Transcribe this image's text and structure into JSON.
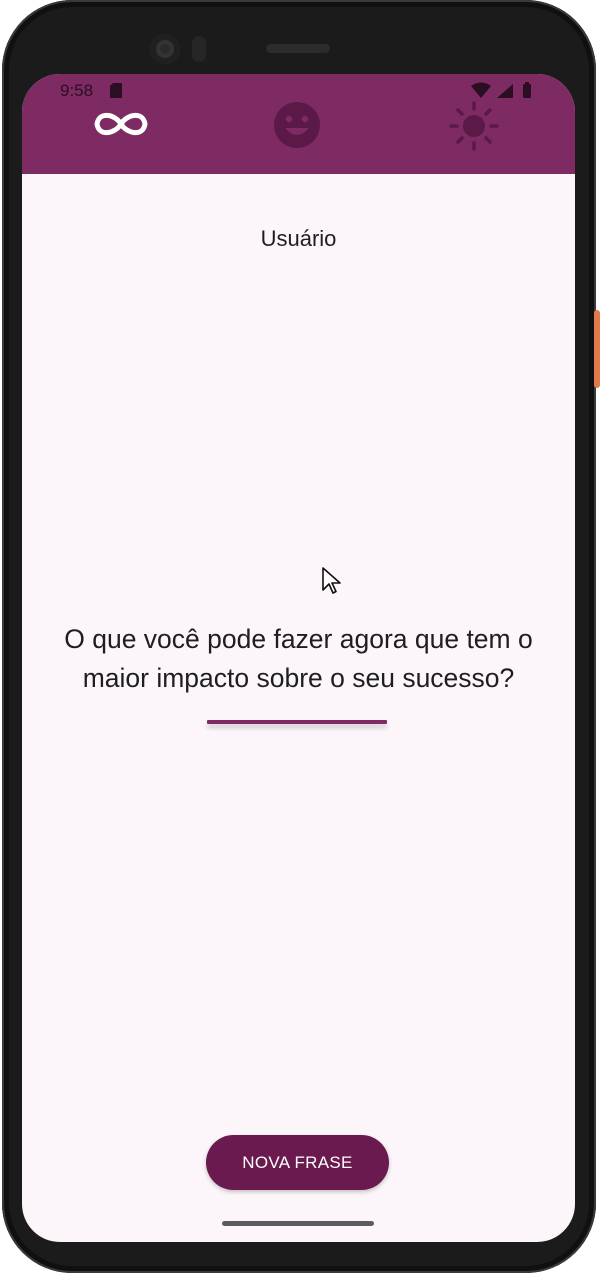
{
  "status_bar": {
    "time": "9:58"
  },
  "app_bar": {
    "icons": [
      "infinity-icon",
      "smiley-face-icon",
      "sun-icon"
    ],
    "background_color": "#7d2b62"
  },
  "main": {
    "username": "Usuário",
    "quote": "O que você pode fazer agora que tem o maior impacto sobre o seu sucesso?",
    "accent_color": "#7d2b62"
  },
  "footer": {
    "button_label": "NOVA FRASE",
    "button_color": "#6b1a4f"
  }
}
